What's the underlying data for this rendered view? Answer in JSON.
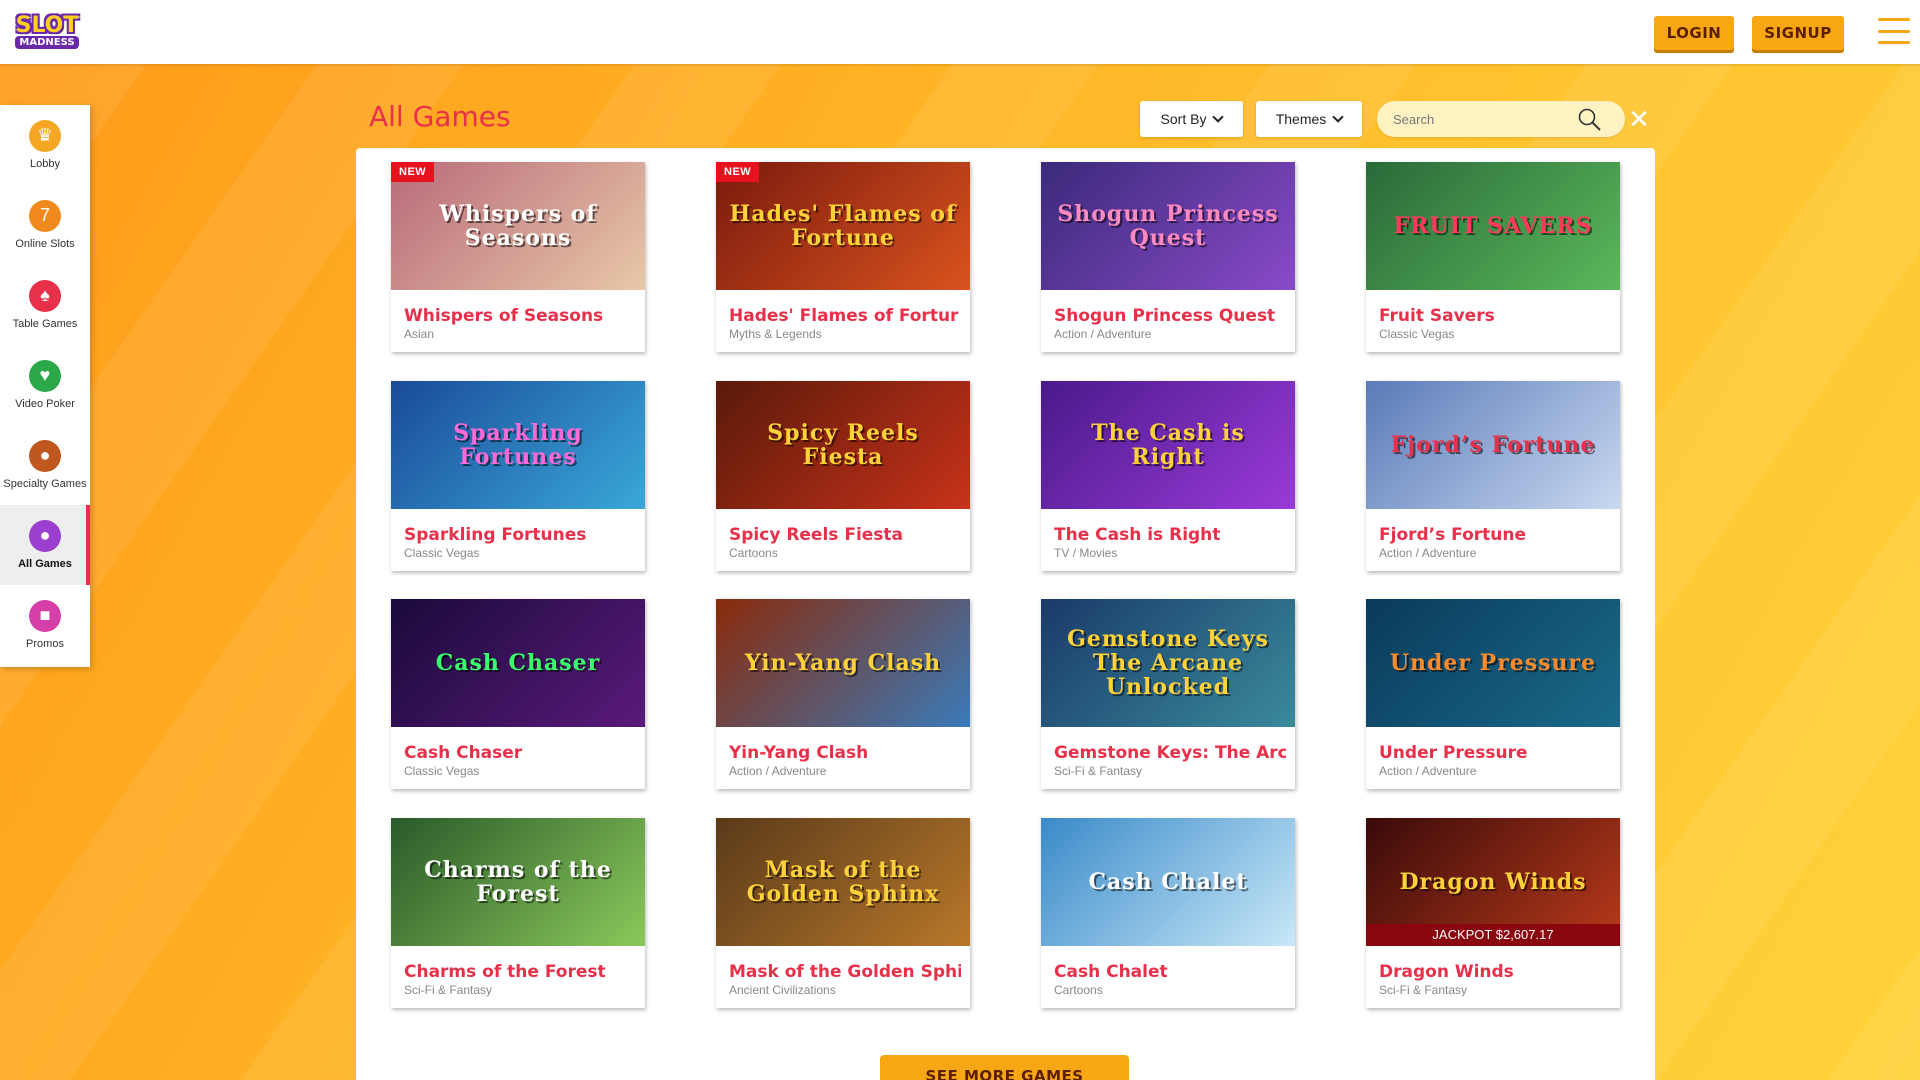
{
  "header": {
    "logo_top": "SLOT",
    "logo_bottom": "MADNESS",
    "login_label": "LOGIN",
    "signup_label": "SIGNUP"
  },
  "sidebar": {
    "items": [
      {
        "label": "Lobby",
        "icon": "lobby-icon",
        "color": "#f5a623"
      },
      {
        "label": "Online Slots",
        "icon": "slot-machine-icon",
        "color": "#f08a1c"
      },
      {
        "label": "Table Games",
        "icon": "poker-chip-icon",
        "color": "#e8304a"
      },
      {
        "label": "Video Poker",
        "icon": "playing-card-icon",
        "color": "#2aa84a"
      },
      {
        "label": "Specialty Games",
        "icon": "bowl-icon",
        "color": "#c0571e"
      },
      {
        "label": "All Games",
        "icon": "fruit-icon",
        "color": "#9b3fd1"
      },
      {
        "label": "Promos",
        "icon": "gift-icon",
        "color": "#d63fa8"
      }
    ],
    "active_index": 5
  },
  "main": {
    "title": "All Games",
    "sort_label": "Sort By",
    "themes_label": "Themes",
    "search_placeholder": "Search",
    "see_more_label": "SEE MORE GAMES"
  },
  "games": [
    {
      "name": "Whispers of Seasons",
      "category": "Asian",
      "thumb_text": "Whispers of Seasons",
      "badge": "NEW",
      "bg": "#b86a7a",
      "bg2": "#e8c8a8",
      "fg": "#ffffff"
    },
    {
      "name": "Hades' Flames of Fortur",
      "category": "Myths & Legends",
      "thumb_text": "Hades' Flames of Fortune",
      "badge": "NEW",
      "bg": "#7a1a0e",
      "bg2": "#d9531e",
      "fg": "#ffd23a"
    },
    {
      "name": "Shogun Princess Quest",
      "category": "Action / Adventure",
      "thumb_text": "Shogun Princess Quest",
      "badge": "",
      "bg": "#3a2a7a",
      "bg2": "#8a4ac8",
      "fg": "#ff8ac0"
    },
    {
      "name": "Fruit Savers",
      "category": "Classic Vegas",
      "thumb_text": "FRUIT SAVERS",
      "badge": "",
      "bg": "#2a6a3a",
      "bg2": "#5ab85a",
      "fg": "#ff3a5a"
    },
    {
      "name": "Sparkling Fortunes",
      "category": "Classic Vegas",
      "thumb_text": "Sparkling Fortunes",
      "badge": "",
      "bg": "#1a4a9a",
      "bg2": "#3aa8d8",
      "fg": "#ff6ad8"
    },
    {
      "name": "Spicy Reels Fiesta",
      "category": "Cartoons",
      "thumb_text": "Spicy Reels Fiesta",
      "badge": "",
      "bg": "#5a1a0a",
      "bg2": "#c8321a",
      "fg": "#ffd23a"
    },
    {
      "name": "The Cash is Right",
      "category": "TV / Movies",
      "thumb_text": "The Cash is Right",
      "badge": "",
      "bg": "#4a1a8a",
      "bg2": "#9a3ad8",
      "fg": "#ffd23a"
    },
    {
      "name": "Fjord’s Fortune",
      "category": "Action / Adventure",
      "thumb_text": "Fjord’s Fortune",
      "badge": "",
      "bg": "#5a7ab8",
      "bg2": "#c8d8f0",
      "fg": "#e8304a"
    },
    {
      "name": "Cash Chaser",
      "category": "Classic Vegas",
      "thumb_text": "Cash Chaser",
      "badge": "",
      "bg": "#1a0a3a",
      "bg2": "#5a1a7a",
      "fg": "#3aff6a"
    },
    {
      "name": "Yin-Yang Clash",
      "category": "Action / Adventure",
      "thumb_text": "Yin-Yang Clash",
      "badge": "",
      "bg": "#8a2a0a",
      "bg2": "#3a7ab8",
      "fg": "#ffd23a"
    },
    {
      "name": "Gemstone Keys: The Arc",
      "category": "Sci-Fi & Fantasy",
      "thumb_text": "Gemstone Keys The Arcane Unlocked",
      "badge": "",
      "bg": "#1a3a6a",
      "bg2": "#3a8a9a",
      "fg": "#ffd23a"
    },
    {
      "name": "Under Pressure",
      "category": "Action / Adventure",
      "thumb_text": "Under Pressure",
      "badge": "",
      "bg": "#0a3a5a",
      "bg2": "#1a6a8a",
      "fg": "#ff8a2a"
    },
    {
      "name": "Charms of the Forest",
      "category": "Sci-Fi & Fantasy",
      "thumb_text": "Charms of the Forest",
      "badge": "",
      "bg": "#2a5a2a",
      "bg2": "#8ac85a",
      "fg": "#ffffff"
    },
    {
      "name": "Mask of the Golden Sphi",
      "category": "Ancient Civilizations",
      "thumb_text": "Mask of the Golden Sphinx",
      "badge": "",
      "bg": "#5a3a1a",
      "bg2": "#b8782a",
      "fg": "#ffd23a"
    },
    {
      "name": "Cash Chalet",
      "category": "Cartoons",
      "thumb_text": "Cash Chalet",
      "badge": "",
      "bg": "#3a8ac8",
      "bg2": "#c8e8f8",
      "fg": "#ffffff"
    },
    {
      "name": "Dragon Winds",
      "category": "Sci-Fi & Fantasy",
      "thumb_text": "Dragon Winds",
      "badge": "",
      "bg": "#3a0a0a",
      "bg2": "#b83a1a",
      "fg": "#ffd23a",
      "jackpot": "JACKPOT $2,607.17"
    }
  ]
}
